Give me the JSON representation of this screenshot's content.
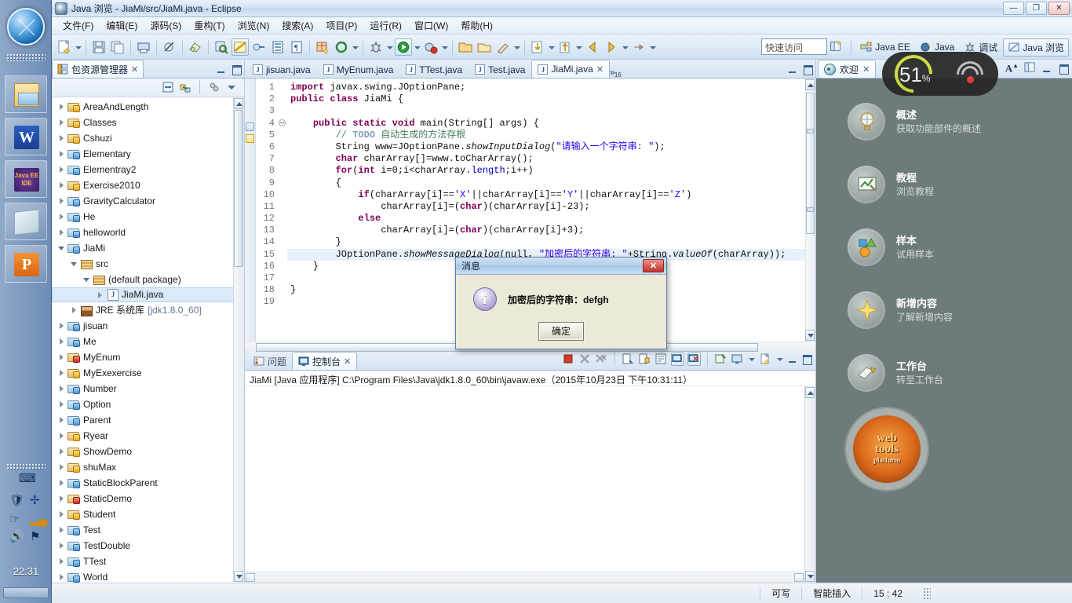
{
  "taskbar": {
    "start_label": "start-orb",
    "items": [
      {
        "name": "windows-explorer",
        "icon": "explorer-icon"
      },
      {
        "name": "word",
        "icon": "word-icon"
      },
      {
        "name": "java-ee-ide",
        "icon": "javaee-icon",
        "label": "Java EE IDE"
      },
      {
        "name": "notes",
        "icon": "note-icon"
      },
      {
        "name": "powerpoint",
        "icon": "powerpoint-icon"
      }
    ],
    "tray": {
      "keyboard": "keyboard-icon",
      "shield": "shield-icon",
      "bluetooth": "bluetooth-icon",
      "hand": "hand-icon",
      "network": "network-signal-icon",
      "volume": "volume-icon",
      "flag": "action-center-flag-icon",
      "clock": "22:31"
    }
  },
  "window": {
    "title": "Java 浏览 - JiaMi/src/JiaMi.java - Eclipse",
    "buttons": {
      "minimize": "—",
      "maximize": "❐",
      "close": "✕"
    }
  },
  "menu": {
    "items": [
      "文件(F)",
      "编辑(E)",
      "源码(S)",
      "重构(T)",
      "浏览(N)",
      "搜索(A)",
      "项目(P)",
      "运行(R)",
      "窗口(W)",
      "帮助(H)"
    ]
  },
  "toolbar": {
    "quick_access_placeholder": "快速访问",
    "perspectives": [
      {
        "label": "Java EE",
        "active": false
      },
      {
        "label": "Java",
        "active": false
      },
      {
        "label": "调试",
        "active": false
      },
      {
        "label": "Java 浏览",
        "active": true
      }
    ]
  },
  "package_explorer": {
    "tab_title": "包资源管理器",
    "tree": [
      {
        "label": "AreaAndLength",
        "indent": 0,
        "icon": "project-warning-icon",
        "twist": "closed"
      },
      {
        "label": "Classes",
        "indent": 0,
        "icon": "project-warning-icon",
        "twist": "closed"
      },
      {
        "label": "Cshuzi",
        "indent": 0,
        "icon": "project-warning-icon",
        "twist": "closed"
      },
      {
        "label": "Elementary",
        "indent": 0,
        "icon": "project-icon",
        "twist": "closed"
      },
      {
        "label": "Elementray2",
        "indent": 0,
        "icon": "project-icon",
        "twist": "closed"
      },
      {
        "label": "Exercise2010",
        "indent": 0,
        "icon": "project-warning-icon",
        "twist": "closed"
      },
      {
        "label": "GravityCalculator",
        "indent": 0,
        "icon": "project-icon",
        "twist": "closed"
      },
      {
        "label": "He",
        "indent": 0,
        "icon": "project-icon",
        "twist": "closed"
      },
      {
        "label": "helloworld",
        "indent": 0,
        "icon": "project-icon",
        "twist": "closed"
      },
      {
        "label": "JiaMi",
        "indent": 0,
        "icon": "project-icon",
        "twist": "open"
      },
      {
        "label": "src",
        "indent": 1,
        "icon": "source-folder-icon",
        "twist": "open"
      },
      {
        "label": "(default package)",
        "indent": 2,
        "icon": "package-icon",
        "twist": "open"
      },
      {
        "label": "JiaMi.java",
        "indent": 3,
        "icon": "java-file-icon",
        "twist": "closed",
        "selected": true
      },
      {
        "label": "JRE 系统库",
        "suffix": "[jdk1.8.0_60]",
        "indent": 1,
        "icon": "library-icon",
        "twist": "closed"
      },
      {
        "label": "jisuan",
        "indent": 0,
        "icon": "project-icon",
        "twist": "closed"
      },
      {
        "label": "Me",
        "indent": 0,
        "icon": "project-icon",
        "twist": "closed"
      },
      {
        "label": "MyEnum",
        "indent": 0,
        "icon": "project-error-icon",
        "twist": "closed"
      },
      {
        "label": "MyExexercise",
        "indent": 0,
        "icon": "project-warning-icon",
        "twist": "closed"
      },
      {
        "label": "Number",
        "indent": 0,
        "icon": "project-icon",
        "twist": "closed"
      },
      {
        "label": "Option",
        "indent": 0,
        "icon": "project-icon",
        "twist": "closed"
      },
      {
        "label": "Parent",
        "indent": 0,
        "icon": "project-icon",
        "twist": "closed"
      },
      {
        "label": "Ryear",
        "indent": 0,
        "icon": "project-warning-icon",
        "twist": "closed"
      },
      {
        "label": "ShowDemo",
        "indent": 0,
        "icon": "project-warning-icon",
        "twist": "closed"
      },
      {
        "label": "shuMax",
        "indent": 0,
        "icon": "project-warning-icon",
        "twist": "closed"
      },
      {
        "label": "StaticBlockParent",
        "indent": 0,
        "icon": "project-icon",
        "twist": "closed"
      },
      {
        "label": "StaticDemo",
        "indent": 0,
        "icon": "project-error-icon",
        "twist": "closed"
      },
      {
        "label": "Student",
        "indent": 0,
        "icon": "project-warning-icon",
        "twist": "closed"
      },
      {
        "label": "Test",
        "indent": 0,
        "icon": "project-icon",
        "twist": "closed"
      },
      {
        "label": "TestDouble",
        "indent": 0,
        "icon": "project-icon",
        "twist": "closed"
      },
      {
        "label": "TTest",
        "indent": 0,
        "icon": "project-icon",
        "twist": "closed"
      },
      {
        "label": "World",
        "indent": 0,
        "icon": "project-icon",
        "twist": "closed"
      }
    ]
  },
  "editor": {
    "tabs": [
      {
        "label": "jisuan.java",
        "active": false
      },
      {
        "label": "MyEnum.java",
        "active": false
      },
      {
        "label": "TTest.java",
        "active": false
      },
      {
        "label": "Test.java",
        "active": false
      },
      {
        "label": "JiaMi.java",
        "active": true
      }
    ],
    "overflow_count": "16",
    "lines": [
      {
        "n": "1",
        "html": "<span class=\"kw\">import</span> javax.swing.JOptionPane;"
      },
      {
        "n": "2",
        "html": "<span class=\"kw\">public</span> <span class=\"kw\">class</span> JiaMi {"
      },
      {
        "n": "3",
        "html": ""
      },
      {
        "n": "4",
        "html": "    <span class=\"kw\">public</span> <span class=\"kw\">static</span> <span class=\"kw\">void</span> main(String[] args) {",
        "fold": true
      },
      {
        "n": "5",
        "html": "        <span class=\"cmt\">// </span><span class=\"task\">TODO</span> <span class=\"cmt\">自动生成的方法存根</span>"
      },
      {
        "n": "6",
        "html": "        String www=JOptionPane.<span class=\"mth\">showInputDialog</span>(<span class=\"str\">\"请输入一个字符串: \"</span>);"
      },
      {
        "n": "7",
        "html": "        <span class=\"kw\">char</span> charArray[]=www.toCharArray();"
      },
      {
        "n": "8",
        "html": "        <span class=\"kw\">for</span>(<span class=\"kw\">int</span> i=0;i&lt;charArray.<span class=\"fld\">length</span>;i++)"
      },
      {
        "n": "9",
        "html": "        {"
      },
      {
        "n": "10",
        "html": "            <span class=\"kw\">if</span>(charArray[i]==<span class=\"str\">'X'</span>||charArray[i]==<span class=\"str\">'Y'</span>||charArray[i]==<span class=\"str\">'Z'</span>)"
      },
      {
        "n": "11",
        "html": "                charArray[i]=(<span class=\"kw\">char</span>)(charArray[i]-23);"
      },
      {
        "n": "12",
        "html": "            <span class=\"kw\">else</span>"
      },
      {
        "n": "13",
        "html": "                charArray[i]=(<span class=\"kw\">char</span>)(charArray[i]+3);"
      },
      {
        "n": "14",
        "html": "        }"
      },
      {
        "n": "15",
        "html": "        JOptionPane.<span class=\"mth\">showMessageDialog</span>(null, <span class=\"str\">\"加密后的字符串: \"</span>+String.<span class=\"mth\">valueOf</span>(charArray));",
        "highlight": true
      },
      {
        "n": "16",
        "html": "    }"
      },
      {
        "n": "17",
        "html": ""
      },
      {
        "n": "18",
        "html": "}"
      },
      {
        "n": "19",
        "html": ""
      }
    ]
  },
  "console": {
    "tabs": [
      {
        "label": "问题",
        "active": false
      },
      {
        "label": "控制台",
        "active": true
      }
    ],
    "process_line": "JiaMi [Java 应用程序] C:\\Program Files\\Java\\jdk1.8.0_60\\bin\\javaw.exe（2015年10月23日 下午10:31:11）",
    "output": ""
  },
  "welcome": {
    "tab_title": "欢迎",
    "items": [
      {
        "title": "概述",
        "subtitle": "获取功能部件的概述",
        "icon": "overview-globe-icon"
      },
      {
        "title": "教程",
        "subtitle": "浏览教程",
        "icon": "tutorials-icon"
      },
      {
        "title": "样本",
        "subtitle": "试用样本",
        "icon": "samples-icon"
      },
      {
        "title": "新增内容",
        "subtitle": "了解新增内容",
        "icon": "whats-new-star-icon"
      },
      {
        "title": "工作台",
        "subtitle": "转至工作台",
        "icon": "workbench-icon"
      }
    ],
    "logo": {
      "line1": "web",
      "line2": "tools",
      "line3": "platform"
    }
  },
  "dialog": {
    "title": "消息",
    "message": "加密后的字符串：defgh",
    "ok_label": "确定",
    "close_label": "✕"
  },
  "overlay": {
    "battery_percent": "51",
    "percent_symbol": "%",
    "wifi": "wifi-icon"
  },
  "statusbar": {
    "writable": "可写",
    "insert_mode": "智能插入",
    "cursor_position": "15 : 42"
  }
}
